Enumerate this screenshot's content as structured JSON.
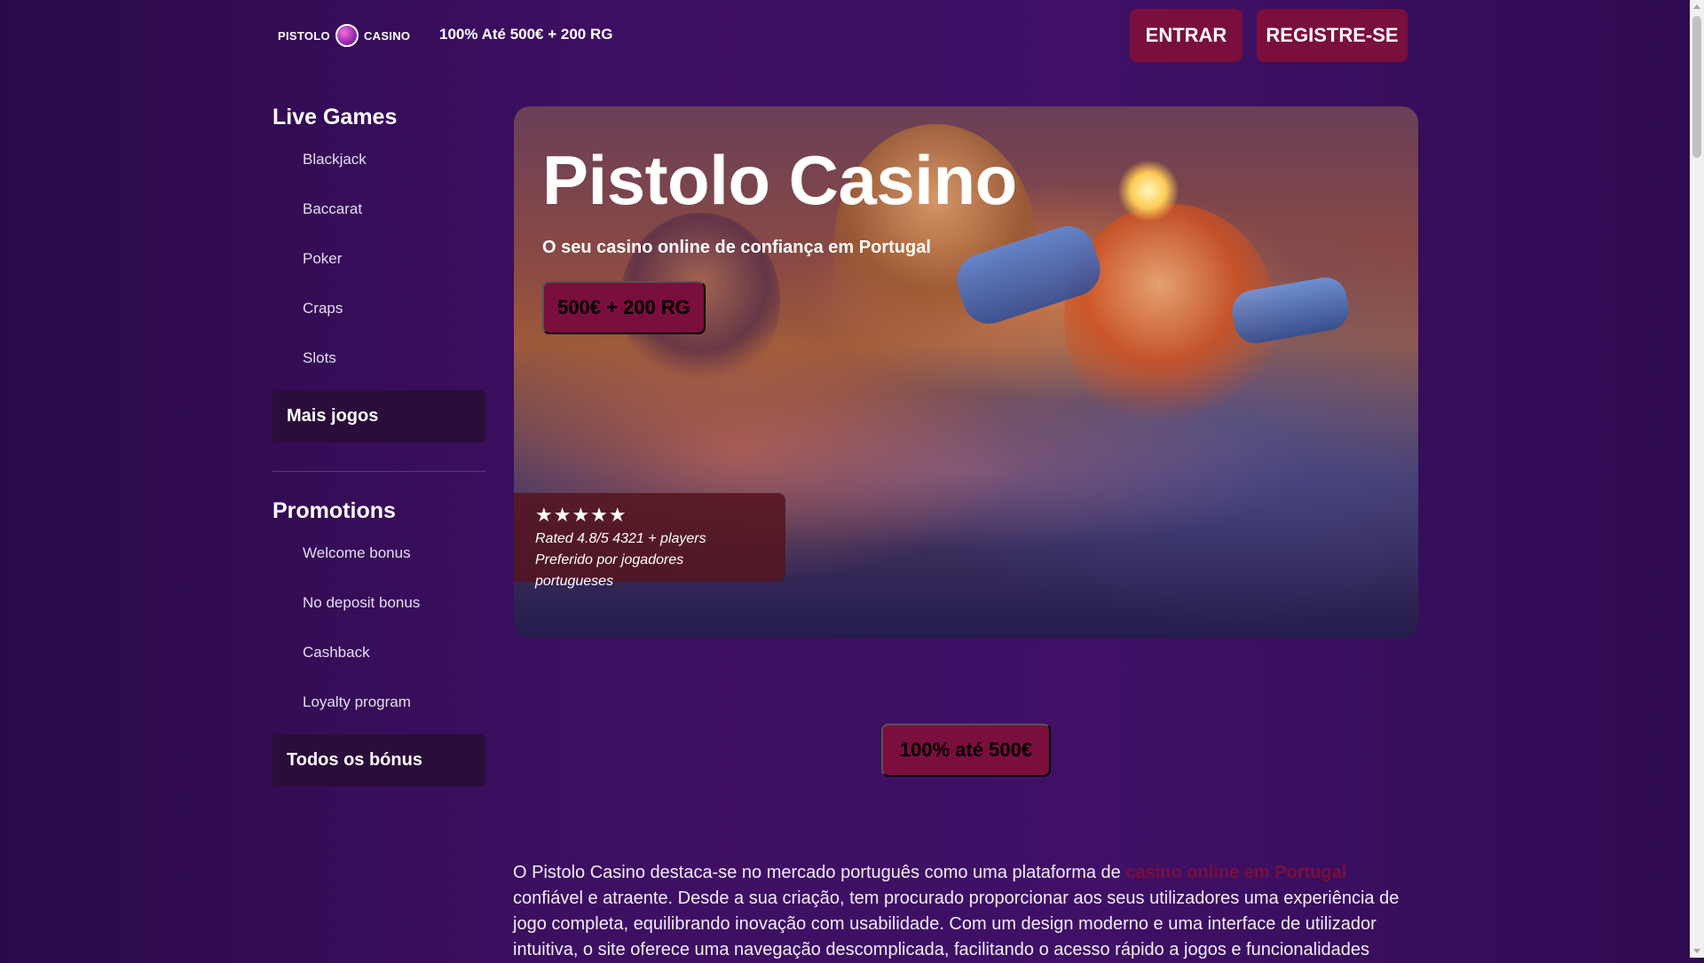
{
  "header": {
    "logo_left": "PISTOLO",
    "logo_right": "CASINO",
    "promo": "100% Até 500€ + 200 RG",
    "login_label": "ENTRAR",
    "register_label": "REGISTRE-SE"
  },
  "sidebar": {
    "live_title": "Live Games",
    "live_items": [
      "Blackjack",
      "Baccarat",
      "Poker",
      "Craps",
      "Slots"
    ],
    "more_games": "Mais jogos",
    "promo_title": "Promotions",
    "promo_items": [
      "Welcome bonus",
      "No deposit bonus",
      "Cashback",
      "Loyalty program"
    ],
    "all_bonus": "Todos os bónus"
  },
  "hero": {
    "title": "Pistolo Casino",
    "subtitle": "O seu casino online de confiança em Portugal",
    "cta": "500€ + 200 RG",
    "rating": {
      "stars": "★★★★★",
      "star_count": 5,
      "rated_prefix": "Rated",
      "score": "4.8/5",
      "players": "4321",
      "players_suffix": "+ players",
      "tagline": "Preferido por jogadores portugueses"
    }
  },
  "bonus_button": "100% até 500€",
  "article": {
    "intro": "O Pistolo Casino destaca-se no mercado português como uma plataforma de",
    "link": "casino online em Portugal",
    "rest": "confiável e atraente. Desde a sua criação, tem procurado proporcionar aos seus utilizadores uma experiência de jogo completa, equilibrando inovação com usabilidade. Com um design moderno e uma interface de utilizador intuitiva, o site oferece uma navegação descomplicada, facilitando o acesso rápido a jogos e funcionalidades"
  },
  "colors": {
    "background": "#3d0f62",
    "accent": "#7a0e3c",
    "sidebar_button": "#2a0d3a"
  }
}
